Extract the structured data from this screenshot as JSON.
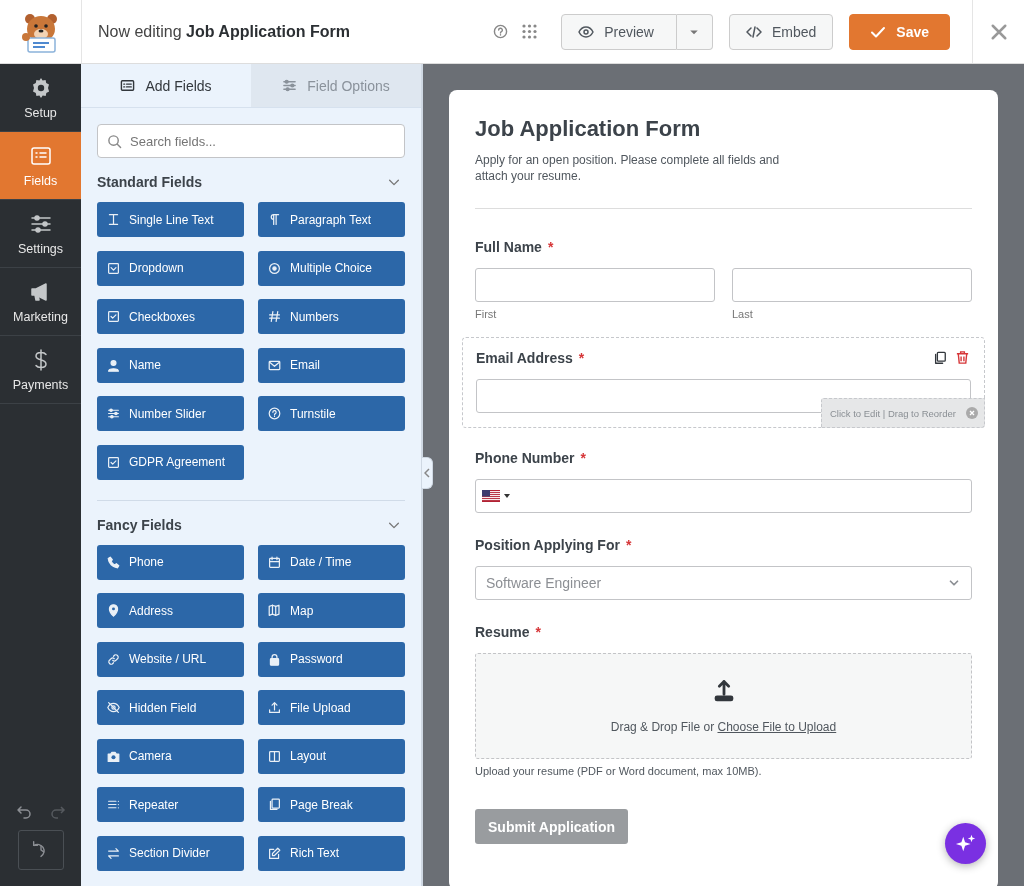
{
  "header": {
    "prefix": "Now editing",
    "form_name": "Job Application Form",
    "buttons": [
      {
        "label": "Preview",
        "kind": "preview"
      },
      {
        "label": "Embed",
        "kind": "embed"
      },
      {
        "label": "Save",
        "kind": "save"
      }
    ]
  },
  "nav": [
    {
      "label": "Setup",
      "selected": false
    },
    {
      "label": "Fields",
      "selected": true
    },
    {
      "label": "Settings",
      "selected": false
    },
    {
      "label": "Marketing",
      "selected": false
    },
    {
      "label": "Payments",
      "selected": false
    }
  ],
  "panel": {
    "tabs": [
      {
        "label": "Add Fields",
        "selected": true
      },
      {
        "label": "Field Options",
        "selected": false
      }
    ],
    "search": {
      "placeholder": "Search fields..."
    },
    "sections": [
      {
        "title": "Standard Fields",
        "expanded": true,
        "fields": [
          "Single Line Text",
          "Paragraph Text",
          "Dropdown",
          "Multiple Choice",
          "Checkboxes",
          "Numbers",
          "Name",
          "Email",
          "Number Slider",
          "Turnstile",
          "GDPR Agreement"
        ]
      },
      {
        "title": "Fancy Fields",
        "expanded": true,
        "fields": [
          "Phone",
          "Date / Time",
          "Address",
          "Map",
          "Website / URL",
          "Password",
          "Hidden Field",
          "File Upload",
          "Camera",
          "Layout",
          "Repeater",
          "Page Break",
          "Section Divider",
          "Rich Text"
        ]
      }
    ]
  },
  "form": {
    "title": "Job Application Form",
    "required_mark": "*",
    "description": "Apply for an open position. Please complete all fields and attach your resume.",
    "fields": [
      {
        "kind": "name",
        "label": "Full Name",
        "required": true,
        "selected": false,
        "sublabels": [
          "First",
          "Last"
        ]
      },
      {
        "kind": "email",
        "label": "Email Address",
        "required": true,
        "selected": true,
        "edit_hint": "Click to Edit | Drag to Reorder"
      },
      {
        "kind": "phone",
        "label": "Phone Number",
        "required": true,
        "selected": false
      },
      {
        "kind": "select",
        "label": "Position Applying For",
        "required": true,
        "selected": false,
        "value": "Software Engineer"
      },
      {
        "kind": "file",
        "label": "Resume",
        "required": true,
        "selected": false,
        "drop_text": "Drag & Drop File or",
        "link": "Choose File to Upload",
        "description": "Upload your resume (PDF or Word document, max 10MB)."
      }
    ],
    "submit": "Submit Application"
  }
}
